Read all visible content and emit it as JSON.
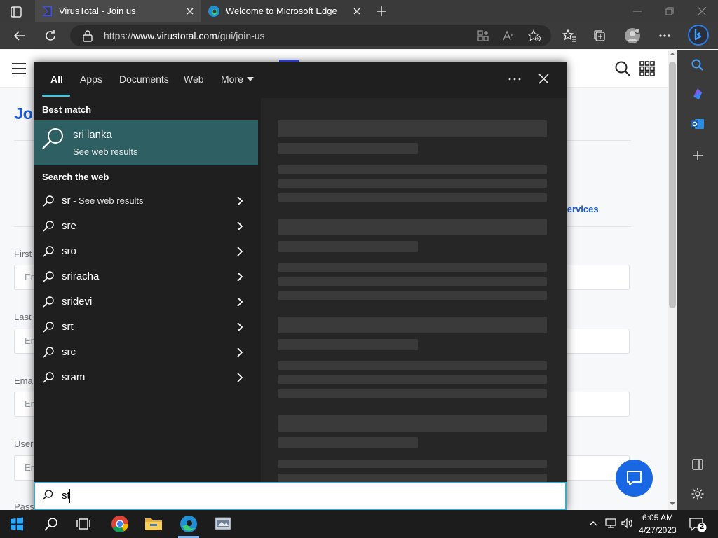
{
  "browser": {
    "tabs": [
      {
        "title": "VirusTotal - Join us",
        "active": true
      },
      {
        "title": "Welcome to Microsoft Edge",
        "active": false
      }
    ],
    "url": {
      "scheme": "https://",
      "host": "www.virustotal.com",
      "path": "/gui/join-us"
    }
  },
  "page": {
    "heading_fragment": "Jo",
    "link_fragment": "n services",
    "labels": [
      "First",
      "Last",
      "Ema",
      "User",
      "Pass"
    ],
    "placeholders": [
      "Er",
      "Er",
      "Er",
      "Er"
    ]
  },
  "start_menu": {
    "filters": [
      {
        "label": "All",
        "selected": true
      },
      {
        "label": "Apps"
      },
      {
        "label": "Documents"
      },
      {
        "label": "Web"
      },
      {
        "label": "More"
      }
    ],
    "best_match_heading": "Best match",
    "best_match": {
      "title": "sri lanka",
      "subtitle": "See web results"
    },
    "search_web_heading": "Search the web",
    "web_results": [
      {
        "label": "sr",
        "suffix": " - See web results"
      },
      {
        "label": "sre"
      },
      {
        "label": "sro"
      },
      {
        "label": "sriracha"
      },
      {
        "label": "sridevi"
      },
      {
        "label": "srt"
      },
      {
        "label": "src"
      },
      {
        "label": "sram"
      }
    ],
    "query": "st"
  },
  "taskbar": {
    "time": "6:05 AM",
    "date": "4/27/2023",
    "notification_count": "2"
  },
  "colors": {
    "accent": "#4cc2d6",
    "best_match_bg": "#2e5f63",
    "chat_button": "#1a67e3"
  }
}
